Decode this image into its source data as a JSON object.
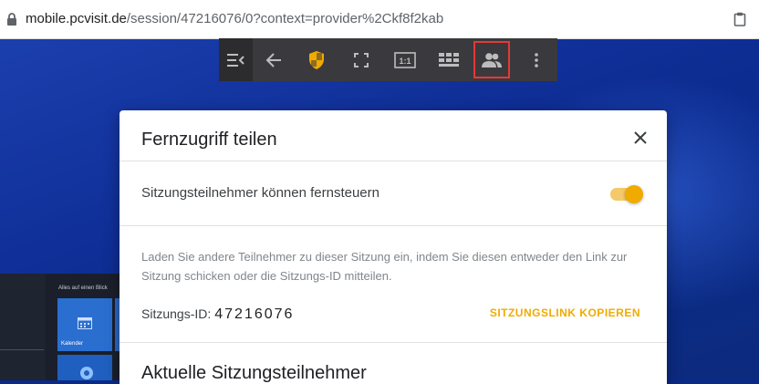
{
  "browser": {
    "url_host": "mobile.pcvisit.de",
    "url_path": "/session/47216076/0?context=provider%2Ckf8f2kab",
    "lock_icon": "lock-icon",
    "clipboard_icon": "clipboard-icon"
  },
  "remote_desktop": {
    "start_menu_caption": "Alles auf einen Blick",
    "tile_calendar_label": "Kalender"
  },
  "toolbar": {
    "buttons": [
      {
        "name": "menu-collapse-button",
        "icon": "menu-collapse-icon"
      },
      {
        "name": "back-button",
        "icon": "arrow-left-icon"
      },
      {
        "name": "security-button",
        "icon": "shield-icon"
      },
      {
        "name": "fullscreen-button",
        "icon": "fullscreen-icon"
      },
      {
        "name": "actual-size-button",
        "icon": "one-to-one-icon",
        "label": "1:1"
      },
      {
        "name": "monitors-button",
        "icon": "monitors-icon"
      },
      {
        "name": "share-access-button",
        "icon": "people-icon",
        "active": true
      },
      {
        "name": "more-button",
        "icon": "more-vertical-icon"
      }
    ]
  },
  "dialog": {
    "title": "Fernzugriff teilen",
    "close_icon": "close-icon",
    "toggle_label": "Sitzungsteilnehmer können fernsteuern",
    "toggle_on": true,
    "description": "Laden Sie andere Teilnehmer zu dieser Sitzung ein, indem Sie diesen entweder den Link zur Sitzung schicken oder die Sitzungs-ID mitteilen.",
    "session_id_label": "Sitzungs-ID:",
    "session_id": "47216076",
    "copy_link_label": "SITZUNGSLINK KOPIEREN",
    "participants_title": "Aktuelle Sitzungsteilnehmer"
  },
  "colors": {
    "accent": "#f0ab00",
    "toolbar_bg": "#3a3a3e",
    "highlight": "#e53935"
  }
}
